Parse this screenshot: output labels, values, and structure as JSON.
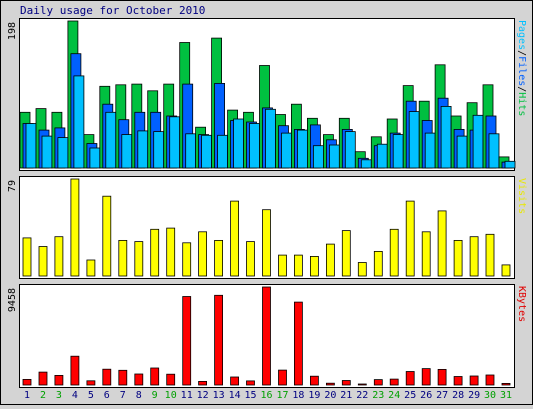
{
  "chart_data": {
    "type": "bar",
    "title": "Daily usage for October 2010",
    "categories": [
      "1",
      "2",
      "3",
      "4",
      "5",
      "6",
      "7",
      "8",
      "9",
      "10",
      "11",
      "12",
      "13",
      "14",
      "15",
      "16",
      "17",
      "18",
      "19",
      "20",
      "21",
      "22",
      "23",
      "24",
      "25",
      "26",
      "27",
      "28",
      "29",
      "30",
      "31"
    ],
    "weekend_days": [
      "2",
      "3",
      "9",
      "10",
      "16",
      "17",
      "23",
      "24",
      "30",
      "31"
    ],
    "panels": [
      {
        "name": "hits-files-pages",
        "max_label": "198",
        "ymax": 198,
        "right_label_parts": [
          {
            "text": "Pages",
            "color": "#00c0ff"
          },
          {
            "text": "/",
            "color": "#000000"
          },
          {
            "text": "Files",
            "color": "#0060ff"
          },
          {
            "text": "/",
            "color": "#000000"
          },
          {
            "text": "Hits",
            "color": "#00c040"
          }
        ],
        "series": [
          {
            "name": "Hits",
            "color": "#00c040",
            "values": [
              75,
              80,
              75,
              198,
              45,
              110,
              112,
              113,
              104,
              113,
              169,
              55,
              175,
              78,
              75,
              138,
              72,
              86,
              67,
              45,
              67,
              22,
              42,
              66,
              111,
              90,
              139,
              70,
              88,
              112,
              15
            ]
          },
          {
            "name": "Files",
            "color": "#0060ff",
            "values": [
              60,
              51,
              54,
              154,
              33,
              86,
              65,
              75,
              75,
              70,
              113,
              45,
              114,
              64,
              62,
              81,
              57,
              52,
              58,
              38,
              52,
              13,
              30,
              47,
              90,
              64,
              94,
              52,
              51,
              70,
              8
            ]
          },
          {
            "name": "Pages",
            "color": "#00c0ff",
            "values": [
              60,
              43,
              41,
              124,
              27,
              75,
              45,
              50,
              49,
              69,
              46,
              44,
              44,
              66,
              60,
              79,
              47,
              51,
              30,
              31,
              49,
              11,
              32,
              45,
              76,
              47,
              83,
              43,
              71,
              46,
              9
            ]
          }
        ]
      },
      {
        "name": "visits",
        "max_label": "79",
        "ymax": 79,
        "right_label_parts": [
          {
            "text": "Visits",
            "color": "#e8e800"
          }
        ],
        "series": [
          {
            "name": "Visits",
            "color": "#ffff00",
            "values": [
              31,
              24,
              32,
              79,
              13,
              65,
              29,
              28,
              38,
              39,
              27,
              36,
              29,
              61,
              28,
              54,
              17,
              17,
              16,
              26,
              37,
              11,
              20,
              38,
              61,
              36,
              53,
              29,
              32,
              34,
              9
            ]
          }
        ]
      },
      {
        "name": "kbytes",
        "max_label": "9458",
        "ymax": 9458,
        "right_label_parts": [
          {
            "text": "KBytes",
            "color": "#e00000"
          }
        ],
        "series": [
          {
            "name": "KBytes",
            "color": "#ff0000",
            "values": [
              541,
              1244,
              930,
              2775,
              402,
              1521,
              1421,
              1065,
              1640,
              1045,
              8542,
              346,
              8660,
              775,
              398,
              9458,
              1434,
              8000,
              854,
              171,
              434,
              89,
              525,
              571,
              1301,
              1583,
              1503,
              820,
              869,
              962,
              150
            ]
          }
        ]
      }
    ],
    "colors": {
      "background": "#d4d4d4",
      "plot_background": "#ffffff",
      "weekday_label": "#000080",
      "weekend_label": "#00a000"
    }
  }
}
